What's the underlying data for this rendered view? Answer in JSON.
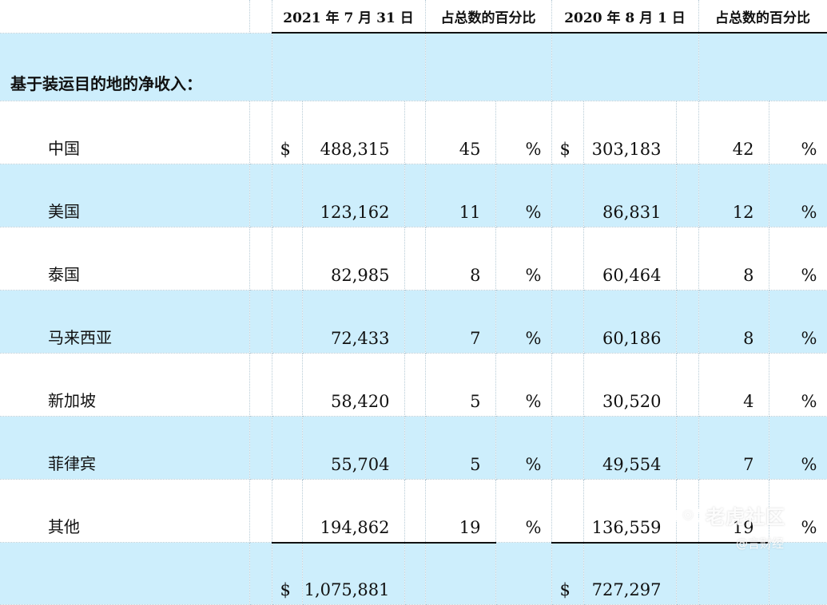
{
  "header": {
    "period_2021": "2021 年 7 月 31 日",
    "pct_label_1": "占总数的百分比",
    "period_2020": "2020 年 8 月 1 日",
    "pct_label_2": "占总数的百分比"
  },
  "section_title": "基于装运目的地的净收入：",
  "currency": "$",
  "percent_sign": "%",
  "rows": [
    {
      "label": "中国",
      "v2021": "488,315",
      "p2021": "45",
      "v2020": "303,183",
      "p2020": "42"
    },
    {
      "label": "美国",
      "v2021": "123,162",
      "p2021": "11",
      "v2020": "86,831",
      "p2020": "12"
    },
    {
      "label": "泰国",
      "v2021": "82,985",
      "p2021": "8",
      "v2020": "60,464",
      "p2020": "8"
    },
    {
      "label": "马来西亚",
      "v2021": "72,433",
      "p2021": "7",
      "v2020": "60,186",
      "p2020": "8"
    },
    {
      "label": "新加坡",
      "v2021": "58,420",
      "p2021": "5",
      "v2020": "30,520",
      "p2020": "4"
    },
    {
      "label": "菲律宾",
      "v2021": "55,704",
      "p2021": "5",
      "v2020": "49,554",
      "p2020": "7"
    },
    {
      "label": "其他",
      "v2021": "194,862",
      "p2021": "19",
      "v2020": "136,559",
      "p2020": "19"
    }
  ],
  "total": {
    "v2021": "1,075,881",
    "v2020": "727,297"
  },
  "watermark": {
    "main": "老虎社区",
    "sub": "@言财经"
  }
}
